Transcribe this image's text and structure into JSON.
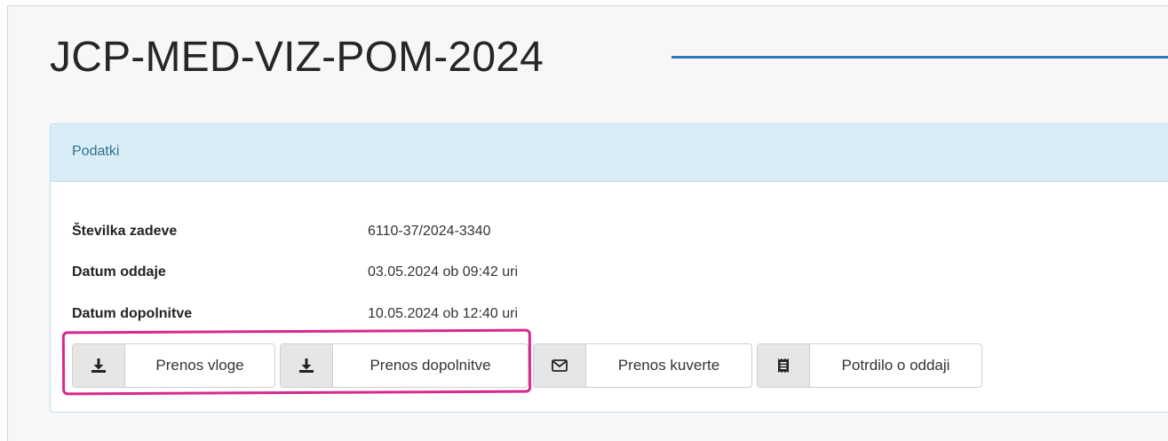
{
  "page": {
    "title": "JCP-MED-VIZ-POM-2024"
  },
  "colors": {
    "accent_line": "#2f78b7",
    "panel_heading_bg": "#d9edf7",
    "highlight": "#d9288d"
  },
  "panel": {
    "heading": "Podatki",
    "fields": [
      {
        "label": "Številka zadeve",
        "value": "6110-37/2024-3340"
      },
      {
        "label": "Datum oddaje",
        "value": "03.05.2024 ob 09:42 uri"
      },
      {
        "label": "Datum dopolnitve",
        "value": "10.05.2024 ob 12:40 uri"
      }
    ],
    "buttons": [
      {
        "label": "Prenos vloge",
        "icon": "download-icon"
      },
      {
        "label": "Prenos dopolnitve",
        "icon": "download-icon"
      },
      {
        "label": "Prenos kuverte",
        "icon": "envelope-icon"
      },
      {
        "label": "Potrdilo o oddaji",
        "icon": "receipt-icon"
      }
    ]
  }
}
